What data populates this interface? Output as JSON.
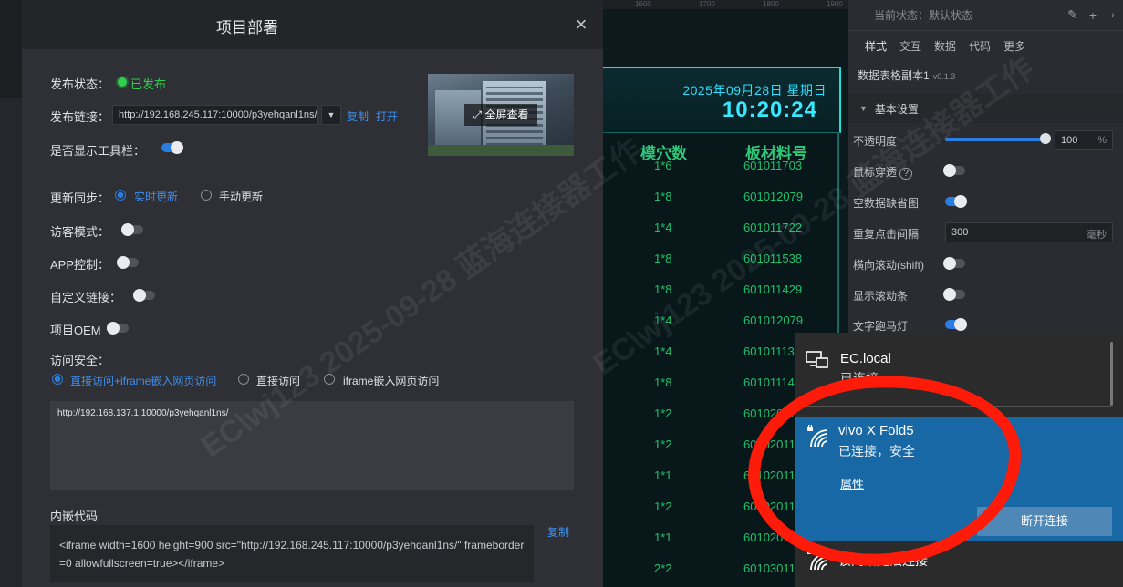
{
  "modal": {
    "title": "项目部署",
    "close_icon": "×",
    "status_label": "发布状态：",
    "status_value": "已发布",
    "link_label": "发布链接：",
    "link_value": "http://192.168.245.117:10000/p3yehqanl1ns/",
    "copy_label": "复制",
    "open_label": "打开",
    "toolbar_label": "是否显示工具栏：",
    "toolbar_on": true,
    "preview_label": "全屏查看",
    "sync_label": "更新同步：",
    "sync_realtime": "实时更新",
    "sync_manual": "手动更新",
    "guest_label": "访客模式：",
    "app_label": "APP控制：",
    "custom_link_label": "自定义链接：",
    "oem_label": "项目OEM",
    "security_label": "访问安全：",
    "security_opt1": "直接访问+iframe嵌入网页访问",
    "security_opt2": "直接访问",
    "security_opt3": "iframe嵌入网页访问",
    "allowed_url": "http://192.168.137.1:10000/p3yehqanl1ns/",
    "embed_label": "内嵌代码",
    "embed_copy": "复制",
    "embed_code": "<iframe width=1600 height=900 src=\"http://192.168.245.117:10000/p3yehqanl1ns/\" frameborder=0 allowfullscreen=true></iframe>"
  },
  "dashboard": {
    "ruler": [
      "1600",
      "1700",
      "1800",
      "1900"
    ],
    "date": "2025年09月28日 星期日",
    "time": "10:20:24",
    "col1": "模穴数",
    "col2": "板材料号",
    "rows": [
      [
        "1*6",
        "601011703"
      ],
      [
        "1*8",
        "601012079"
      ],
      [
        "1*4",
        "601011722"
      ],
      [
        "1*8",
        "601011538"
      ],
      [
        "1*8",
        "601011429"
      ],
      [
        "1*4",
        "601012079"
      ],
      [
        "1*4",
        "60101113"
      ],
      [
        "1*8",
        "60101114"
      ],
      [
        "1*2",
        "60102011"
      ],
      [
        "1*2",
        "60102011"
      ],
      [
        "1*1",
        "60102011"
      ],
      [
        "1*2",
        "60102011"
      ],
      [
        "1*1",
        "60102011"
      ],
      [
        "2*2",
        "60103011"
      ]
    ]
  },
  "panel": {
    "state_label": "当前状态：默认状态",
    "tabs": [
      "样式",
      "交互",
      "数据",
      "代码",
      "更多"
    ],
    "component_name": "数据表格副本1",
    "component_version": "v0.1.3",
    "section": "基本设置",
    "opacity_label": "不透明度",
    "opacity_value": "100",
    "opacity_unit": "%",
    "mouse_through": "鼠标穿透",
    "empty_default": "空数据缺省图",
    "repeat_click": "重复点击间隔",
    "repeat_value": "300",
    "repeat_unit": "毫秒",
    "h_scroll": "横向滚动(shift)",
    "show_scrollbar": "显示滚动条",
    "marquee": "文字跑马灯"
  },
  "wifi": {
    "net1_name": "EC.local",
    "net1_status": "已连接",
    "net2_name": "vivo X Fold5",
    "net2_status": "已连接，安全",
    "properties": "属性",
    "disconnect": "断开连接",
    "net3_name": "该网络无法连接"
  },
  "watermark": "EC\\wj123 2025-09-28 蓝海连接器工作"
}
